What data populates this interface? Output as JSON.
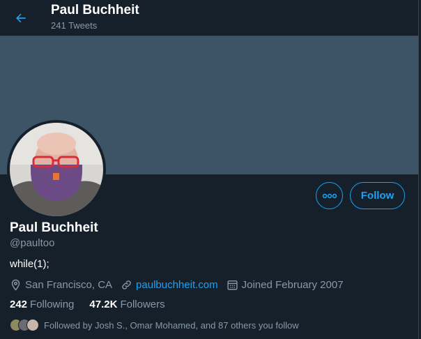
{
  "header": {
    "title": "Paul Buchheit",
    "tweet_count": "241 Tweets"
  },
  "profile": {
    "display_name": "Paul Buchheit",
    "handle": "@paultoo",
    "bio": "while(1);",
    "location": "San Francisco, CA",
    "website": "paulbuchheit.com",
    "joined": "Joined February 2007",
    "following_count": "242",
    "following_label": "Following",
    "followers_count": "47.2K",
    "followers_label": "Followers",
    "followed_by": "Followed by Josh S., Omar Mohamed, and 87 others you follow"
  },
  "actions": {
    "follow_label": "Follow",
    "more_icon": "more-icon"
  },
  "colors": {
    "background": "#15202b",
    "banner": "#3d5466",
    "accent": "#1da1f2",
    "secondary_text": "#8899a6"
  }
}
